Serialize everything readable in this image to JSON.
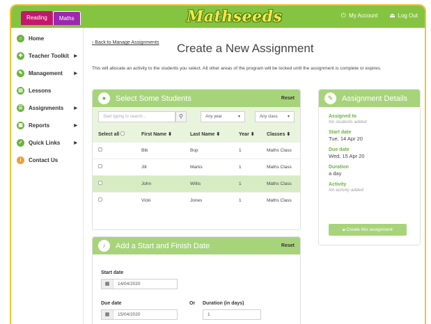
{
  "topbar": {
    "tabs": [
      "Reading",
      "Maths"
    ],
    "logo": "Mathseeds",
    "account": "My Account",
    "logout": "Log Out"
  },
  "sidebar": {
    "items": [
      {
        "label": "Home",
        "icon": "home-icon",
        "has_submenu": false
      },
      {
        "label": "Teacher Toolkit",
        "icon": "toolkit-icon",
        "has_submenu": true
      },
      {
        "label": "Management",
        "icon": "pencil-icon",
        "has_submenu": true
      },
      {
        "label": "Lessons",
        "icon": "lessons-icon",
        "has_submenu": false
      },
      {
        "label": "Assignments",
        "icon": "assignments-icon",
        "has_submenu": true
      },
      {
        "label": "Reports",
        "icon": "reports-icon",
        "has_submenu": true
      },
      {
        "label": "Quick Links",
        "icon": "quick-links-icon",
        "has_submenu": true
      },
      {
        "label": "Contact Us",
        "icon": "contact-icon",
        "has_submenu": false
      }
    ]
  },
  "main": {
    "back_link": "Back to Manage Assignments",
    "title": "Create a New Assignment",
    "intro": "This will allocate an activity to the students you select. All other areas of the program will be locked until the assignment is complete or expires."
  },
  "students": {
    "title": "Select Some Students",
    "reset": "Reset",
    "search_placeholder": "Start typing to search...",
    "year_select": "Any year",
    "class_select": "Any class",
    "columns": [
      "Select all",
      "First Name",
      "Last Name",
      "Year",
      "Classes"
    ],
    "rows": [
      {
        "first": "Bib",
        "last": "Bop",
        "year": "1",
        "classes": "Maths Class"
      },
      {
        "first": "Jill",
        "last": "Marks",
        "year": "1",
        "classes": "Maths Class"
      },
      {
        "first": "John",
        "last": "Willis",
        "year": "1",
        "classes": "Maths Class"
      },
      {
        "first": "Vicki",
        "last": "Jones",
        "year": "1",
        "classes": "Maths Class"
      }
    ]
  },
  "dates": {
    "title": "Add a Start and Finish Date",
    "reset": "Reset",
    "start_label": "Start date",
    "start_value": "14/04/2020",
    "due_label": "Due date",
    "due_value": "15/04/2020",
    "or": "Or",
    "duration_label": "Duration (in days)",
    "duration_value": "1"
  },
  "details": {
    "title": "Assignment Details",
    "assigned_label": "Assigned to",
    "assigned_value": "No students added",
    "start_label": "Start date",
    "start_value": "Tue, 14 Apr 20",
    "due_label": "Due date",
    "due_value": "Wed, 15 Apr 20",
    "duration_label": "Duration",
    "duration_value": "a day",
    "activity_label": "Activity",
    "activity_value": "No activity added",
    "create_button": "Create this assignment"
  },
  "colors": {
    "brand_green": "#85c441",
    "light_green": "#a7d47a",
    "frame_yellow": "#f2c233",
    "reading_tab": "#c2186b",
    "maths_tab": "#9c27b0"
  }
}
